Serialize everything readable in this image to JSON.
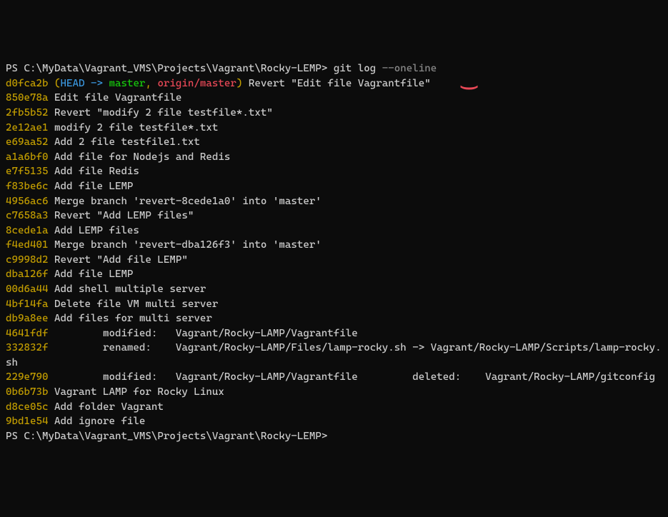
{
  "prompt_prefix": "PS ",
  "cwd": "C:\\MyData\\Vagrant_VMS\\Projects\\Vagrant\\Rocky-LEMP",
  "prompt_suffix": "> ",
  "command": "git log",
  "command_arg": " --oneline",
  "head_open": "(",
  "head_label": "HEAD -> ",
  "branch_local": "master",
  "sep": ", ",
  "branch_remote": "origin/master",
  "head_close": ")",
  "commits": [
    {
      "hash": "d0fca2b",
      "msg": " Revert \"Edit file Vagrantfile\"",
      "head": true
    },
    {
      "hash": "850e78a",
      "msg": " Edit file Vagrantfile"
    },
    {
      "hash": "2fb5b52",
      "msg": " Revert \"modify 2 file testfile*.txt\""
    },
    {
      "hash": "2e12ae1",
      "msg": " modify 2 file testfile*.txt"
    },
    {
      "hash": "e69aa52",
      "msg": " Add 2 file testfile1.txt"
    },
    {
      "hash": "a1a6bf0",
      "msg": " Add file for Nodejs and Redis"
    },
    {
      "hash": "e7f5135",
      "msg": " Add file Redis"
    },
    {
      "hash": "f83be6c",
      "msg": " Add file LEMP"
    },
    {
      "hash": "4956ac6",
      "msg": " Merge branch 'revert-8cede1a0' into 'master'"
    },
    {
      "hash": "c7658a3",
      "msg": " Revert \"Add LEMP files\""
    },
    {
      "hash": "8cede1a",
      "msg": " Add LEMP files"
    },
    {
      "hash": "f4ed401",
      "msg": " Merge branch 'revert-dba126f3' into 'master'"
    },
    {
      "hash": "c9998d2",
      "msg": " Revert \"Add file LEMP\""
    },
    {
      "hash": "dba126f",
      "msg": " Add file LEMP"
    },
    {
      "hash": "00d6a44",
      "msg": " Add shell multiple server"
    },
    {
      "hash": "4bf14fa",
      "msg": " Delete file VM multi server"
    },
    {
      "hash": "db9a8ee",
      "msg": " Add files for multi server"
    },
    {
      "hash": "4641fdf",
      "msg": "         modified:   Vagrant/Rocky-LAMP/Vagrantfile"
    },
    {
      "hash": "332832f",
      "msg": "         renamed:    Vagrant/Rocky-LAMP/Files/lamp-rocky.sh -> Vagrant/Rocky-LAMP/Scripts/lamp-rocky.sh"
    },
    {
      "hash": "229e790",
      "msg": "         modified:   Vagrant/Rocky-LAMP/Vagrantfile         deleted:    Vagrant/Rocky-LAMP/gitconfig"
    },
    {
      "hash": "0b6b73b",
      "msg": " Vagrant LAMP for Rocky Linux"
    },
    {
      "hash": "d8ce05c",
      "msg": " Add folder Vagrant"
    },
    {
      "hash": "9bd1e54",
      "msg": " Add ignore file"
    }
  ],
  "annotation_glyph": "⌣"
}
